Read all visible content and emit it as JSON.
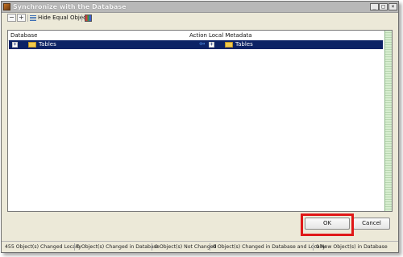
{
  "window": {
    "title": "Synchronize with the Database"
  },
  "toolbar": {
    "hide_equal_label": "Hide Equal Objects"
  },
  "grid": {
    "headers": {
      "database": "Database",
      "action": "Action",
      "local_metadata": "Local Metadata"
    },
    "rows": [
      {
        "database_item": "Tables",
        "local_item": "Tables"
      }
    ]
  },
  "buttons": {
    "ok": "OK",
    "cancel": "Cancel"
  },
  "status": [
    "455 Object(s) Changed Locally",
    "0 Object(s) Changed in Database",
    "0 Object(s) Not Changed",
    "0 Object(s) Changed in Database and Locally",
    "0 New Object(s) in Database"
  ],
  "colors": {
    "selection": "#0c2265",
    "highlight_box": "#e01818",
    "window_bg": "#ece9d8"
  }
}
